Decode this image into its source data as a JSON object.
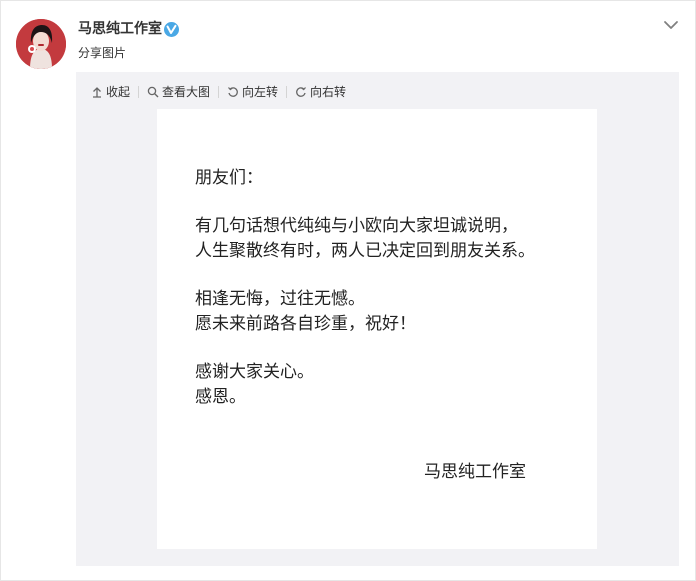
{
  "post": {
    "username": "马思纯工作室",
    "subtitle": "分享图片",
    "verified_color": "#4aa8e5"
  },
  "toolbar": {
    "collapse": "收起",
    "view_large": "查看大图",
    "rotate_left": "向左转",
    "rotate_right": "向右转"
  },
  "letter": {
    "greeting": "朋友们：",
    "para1_line1": "有几句话想代纯纯与小欧向大家坦诚说明，",
    "para1_line2": "人生聚散终有时，两人已决定回到朋友关系。",
    "para2_line1": "相逢无悔，过往无憾。",
    "para2_line2": "愿未来前路各自珍重，祝好！",
    "para3_line1": "感谢大家关心。",
    "para3_line2": "感恩。",
    "signature": "马思纯工作室"
  },
  "icons": {
    "avatar": "avatar",
    "verified": "verified-v-icon",
    "more": "chevron-down-icon",
    "collapse": "arrow-up-icon",
    "view_large": "search-icon",
    "rotate_left": "rotate-left-icon",
    "rotate_right": "rotate-right-icon"
  }
}
